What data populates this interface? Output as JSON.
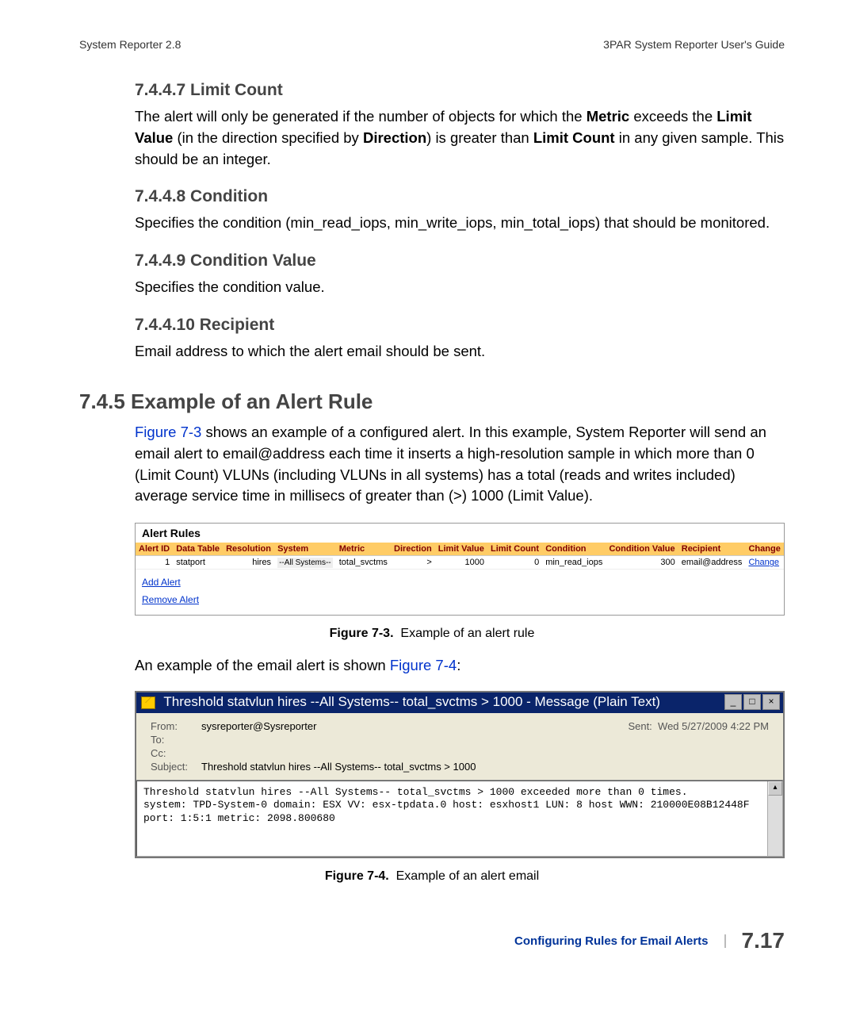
{
  "runhead": {
    "left": "System Reporter 2.8",
    "right": "3PAR System Reporter User's Guide"
  },
  "s7447": {
    "title": "7.4.4.7 Limit Count",
    "p1a": "The alert will only be generated if the number of objects for which the ",
    "p1b": "Metric",
    "p1c": " exceeds the ",
    "p1d": "Limit Value",
    "p1e": " (in the direction specified by ",
    "p1f": "Direction",
    "p1g": ") is greater than ",
    "p1h": "Limit Count",
    "p1i": " in any given sample. This should be an integer."
  },
  "s7448": {
    "title": "7.4.4.8 Condition",
    "p": "Specifies the condition (min_read_iops, min_write_iops, min_total_iops) that should be monitored."
  },
  "s7449": {
    "title": "7.4.4.9 Condition Value",
    "p": "Specifies the condition value."
  },
  "s74410": {
    "title": "7.4.4.10 Recipient",
    "p": "Email address to which the alert email should be sent."
  },
  "s745": {
    "title": "7.4.5 Example of an Alert Rule",
    "p1a": "Figure 7-3",
    "p1b": " shows an example of a configured alert. In this example, System Reporter will send an email alert to email@address each time it inserts a high-resolution sample in which more than 0 (Limit Count) VLUNs (including VLUNs in all systems) has a total (reads and writes included) average service time in millisecs of greater than (>) 1000 (Limit Value).",
    "p2a": "An example of the email alert is shown ",
    "p2b": "Figure 7-4",
    "p2c": ":"
  },
  "alert": {
    "title": "Alert Rules",
    "headers": [
      "Alert ID",
      "Data Table",
      "Resolution",
      "System",
      "Metric",
      "Direction",
      "Limit Value",
      "Limit Count",
      "Condition",
      "Condition Value",
      "Recipient",
      "Change"
    ],
    "row": {
      "id": "1",
      "table": "statport",
      "res": "hires",
      "system": "--All Systems--",
      "metric": "total_svctms",
      "dir": ">",
      "lval": "1000",
      "lcount": "0",
      "cond": "min_read_iops",
      "cval": "300",
      "recip": "email@address",
      "change": "Change"
    },
    "add": "Add Alert",
    "remove": "Remove Alert"
  },
  "fig73": {
    "label": "Figure 7-3.",
    "caption": "Example of an alert rule"
  },
  "email": {
    "title_text": "Threshold statvlun hires --All Systems-- total_svctms > 1000 - Message (Plain Text)",
    "minbtn": "_",
    "maxbtn": "□",
    "closebtn": "×",
    "from_lbl": "From:",
    "from_val": "sysreporter@Sysreporter",
    "sent_lbl": "Sent:",
    "sent_val": "Wed 5/27/2009 4:22 PM",
    "to_lbl": "To:",
    "cc_lbl": "Cc:",
    "subj_lbl": "Subject:",
    "subj_val": "Threshold statvlun hires --All Systems-- total_svctms > 1000",
    "body": "Threshold statvlun hires --All Systems-- total_svctms > 1000 exceeded more than 0 times.\nsystem: TPD-System-0 domain: ESX VV: esx-tpdata.0 host: esxhost1 LUN: 8 host WWN: 210000E08B12448F\nport: 1:5:1 metric: 2098.800680",
    "scroll_up": "▴"
  },
  "fig74": {
    "label": "Figure 7-4.",
    "caption": "Example of an alert email"
  },
  "footer": {
    "label": "Configuring Rules for Email Alerts",
    "num": "7.17"
  }
}
